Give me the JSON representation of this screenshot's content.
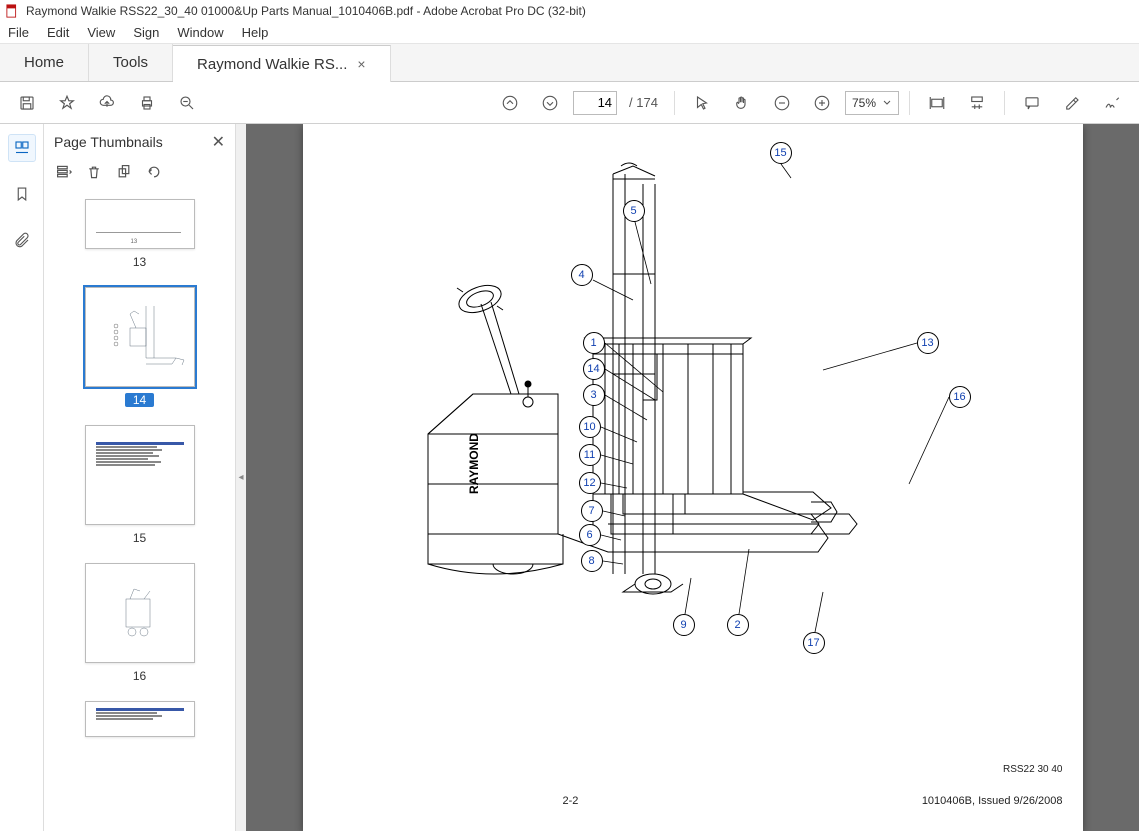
{
  "window": {
    "title": "Raymond Walkie RSS22_30_40 01000&Up Parts Manual_1010406B.pdf - Adobe Acrobat Pro DC (32-bit)"
  },
  "menu": {
    "items": [
      "File",
      "Edit",
      "View",
      "Sign",
      "Window",
      "Help"
    ]
  },
  "tabs": {
    "home": "Home",
    "tools": "Tools",
    "doc": "Raymond Walkie RS...",
    "close": "×"
  },
  "toolbar": {
    "page_current": "14",
    "page_total": "/ 174",
    "zoom": "75%"
  },
  "thumbs": {
    "title": "Page Thumbnails",
    "pages": [
      "13",
      "14",
      "15",
      "16"
    ],
    "selected": "14"
  },
  "document": {
    "callouts": [
      "15",
      "5",
      "4",
      "1",
      "14",
      "3",
      "10",
      "11",
      "12",
      "7",
      "6",
      "8",
      "9",
      "2",
      "17",
      "13",
      "16"
    ],
    "footer_left": "2-2",
    "footer_sub": "RSS22 30 40",
    "footer_right": "1010406B, Issued 9/26/2008"
  }
}
